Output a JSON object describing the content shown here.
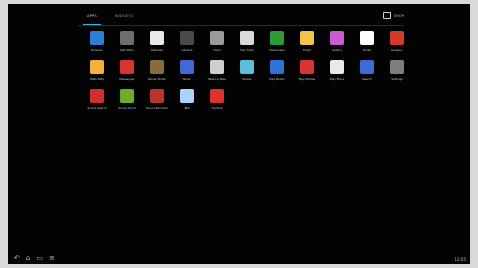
{
  "tabs": [
    {
      "label": "APPS"
    },
    {
      "label": "WIDGETS"
    }
  ],
  "store": {
    "label": "SHOP"
  },
  "apps": [
    {
      "label": "Browser",
      "color": "#2e7fd6"
    },
    {
      "label": "Calculator",
      "color": "#6d6d6d"
    },
    {
      "label": "Calendar",
      "color": "#e9e9e9"
    },
    {
      "label": "Camera",
      "color": "#4a4a4a"
    },
    {
      "label": "Clock",
      "color": "#9a9a9a"
    },
    {
      "label": "Dev Tools",
      "color": "#d9d9d9"
    },
    {
      "label": "Downloads",
      "color": "#2f9a38"
    },
    {
      "label": "Email",
      "color": "#f2c44a"
    },
    {
      "label": "Gallery",
      "color": "#c95bd4"
    },
    {
      "label": "Gmail",
      "color": "#ffffff"
    },
    {
      "label": "Google+",
      "color": "#d23a2a"
    },
    {
      "label": "Hello Kitty",
      "color": "#f3b23a"
    },
    {
      "label": "Messenger",
      "color": "#d9342f"
    },
    {
      "label": "Movie Studio",
      "color": "#8a6b3d"
    },
    {
      "label": "Music",
      "color": "#3f6ad1"
    },
    {
      "label": "News & Wea",
      "color": "#cfcfcf"
    },
    {
      "label": "Places",
      "color": "#5bbfd8"
    },
    {
      "label": "Play Books",
      "color": "#2f73d8"
    },
    {
      "label": "Play Movies",
      "color": "#d9342f"
    },
    {
      "label": "Play Store",
      "color": "#e9e9e9"
    },
    {
      "label": "Search",
      "color": "#3f6ad1"
    },
    {
      "label": "Settings",
      "color": "#7b7f84"
    },
    {
      "label": "Sound Search",
      "color": "#d12f2f"
    },
    {
      "label": "Sound Droid",
      "color": "#6cae2a"
    },
    {
      "label": "Sound Recorder",
      "color": "#b9342a"
    },
    {
      "label": "Talk",
      "color": "#a9d3ff"
    },
    {
      "label": "YouTube",
      "color": "#d9342f"
    }
  ],
  "navbar": {
    "back": "↶",
    "home": "⌂",
    "recent": "▭",
    "menu": "≡"
  },
  "status": {
    "time": "12:05"
  }
}
